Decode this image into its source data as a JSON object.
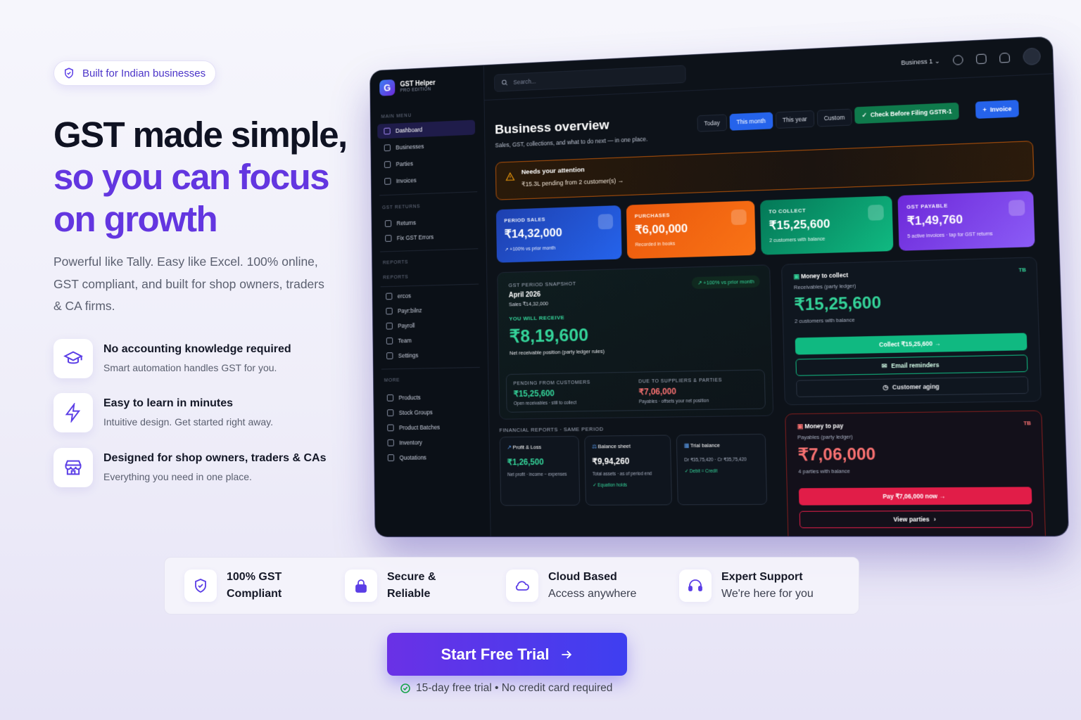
{
  "hero": {
    "badge": "Built for Indian businesses",
    "title_line1": "GST made simple,",
    "title_line2": "so you can focus",
    "title_line3": "on growth",
    "description": "Powerful like Tally. Easy like Excel. 100% online, GST compliant, and built for shop owners, traders & CA firms.",
    "features": [
      {
        "icon": "graduation-cap-icon",
        "title": "No accounting knowledge required",
        "subtitle": "Smart automation handles GST for you."
      },
      {
        "icon": "lightning-icon",
        "title": "Easy to learn in minutes",
        "subtitle": "Intuitive design. Get started right away."
      },
      {
        "icon": "store-icon",
        "title": "Designed for shop owners, traders & CAs",
        "subtitle": "Everything you need in one place."
      }
    ]
  },
  "trust": [
    {
      "icon": "shield-check-icon",
      "line1": "100% GST",
      "line2": "Compliant"
    },
    {
      "icon": "lock-icon",
      "line1": "Secure &",
      "line2": "Reliable"
    },
    {
      "icon": "cloud-icon",
      "line1": "Cloud Based",
      "line2": "Access anywhere"
    },
    {
      "icon": "headset-icon",
      "line1": "Expert Support",
      "line2": "We're here for you"
    }
  ],
  "cta": {
    "label": "Start Free Trial",
    "note": "15-day free trial • No credit card required"
  },
  "app": {
    "brand": "GST Helper",
    "edition": "PRO EDITION",
    "search_placeholder": "Search...",
    "business_selector": "Business 1",
    "sidebar": {
      "main_menu": "MAIN MENU",
      "main_items": [
        "Dashboard",
        "Businesses",
        "Parties",
        "Invoices"
      ],
      "gst_returns": "GST RETURNS",
      "gst_items": [
        "Returns",
        "Fix GST Errors"
      ],
      "reports1": "REPORTS",
      "reports2": "REPORTS",
      "report_items": [
        "ercos",
        "Payr:bilnz",
        "Payroll",
        "Team",
        "Settings"
      ],
      "more": "MORE",
      "more_items": [
        "Products",
        "Stock Groups",
        "Product Batches",
        "Inventory",
        "Quotations"
      ]
    },
    "overview": {
      "title": "Business overview",
      "subtitle": "Sales, GST, collections, and what to do next — in one place.",
      "periods": [
        "Today",
        "This month",
        "This year",
        "Custom"
      ],
      "check_button": "Check Before Filing GSTR-1",
      "invoice_button": "Invoice"
    },
    "alert": {
      "title": "Needs your attention",
      "text": "₹15.3L pending from 2 customer(s) →"
    },
    "kpis": [
      {
        "label": "PERIOD SALES",
        "value": "₹14,32,000",
        "note": "↗ +100% vs prior month",
        "color": "#1d4ed8"
      },
      {
        "label": "PURCHASES",
        "value": "₹6,00,000",
        "note": "Recorded in books",
        "color": "#f97316"
      },
      {
        "label": "TO COLLECT",
        "value": "₹15,25,600",
        "note": "2 customers with balance",
        "color": "#059669"
      },
      {
        "label": "GST PAYABLE",
        "value": "₹1,49,760",
        "note": "5 active invoices · tap for GST returns",
        "color": "#7c3aed"
      }
    ],
    "snapshot": {
      "label": "GST PERIOD SNAPSHOT",
      "period": "April 2026",
      "sales": "Sales ₹14,32,000",
      "badge": "↗ +100% vs prior month",
      "receive_label": "YOU WILL RECEIVE",
      "receive_value": "₹8,19,600",
      "receive_note": "Net receivable position (party ledger rules)",
      "pending_label": "PENDING FROM CUSTOMERS",
      "pending_value": "₹15,25,600",
      "pending_note": "Open receivables · still to collect",
      "due_label": "DUE TO SUPPLIERS & PARTIES",
      "due_value": "₹7,06,000",
      "due_note": "Payables · offsets your net position"
    },
    "financial": {
      "label": "FINANCIAL REPORTS · SAME PERIOD",
      "pl_title": "Profit & Loss",
      "pl_value": "₹1,26,500",
      "pl_note": "Net profit · income − expenses",
      "bs_title": "Balance sheet",
      "bs_value": "₹9,94,260",
      "bs_note": "Total assets · as of period end",
      "bs_status": "Equation holds",
      "tb_title": "Trial balance",
      "tb_note": "Dr ₹35,75,420 · Cr ₹35,75,420",
      "tb_status": "Debit = Credit"
    },
    "collect": {
      "title": "Money to collect",
      "tag": "TB",
      "sub": "Receivables (party ledger)",
      "value": "₹15,25,600",
      "note": "2 customers with balance",
      "btn1": "Collect ₹15,25,600 →",
      "btn2": "Email reminders",
      "btn3": "Customer aging"
    },
    "pay": {
      "title": "Money to pay",
      "tag": "TB",
      "sub": "Payables (party ledger)",
      "value": "₹7,06,000",
      "note": "4 parties with balance",
      "btn1": "Pay ₹7,06,000 now →",
      "btn2": "View parties"
    }
  }
}
